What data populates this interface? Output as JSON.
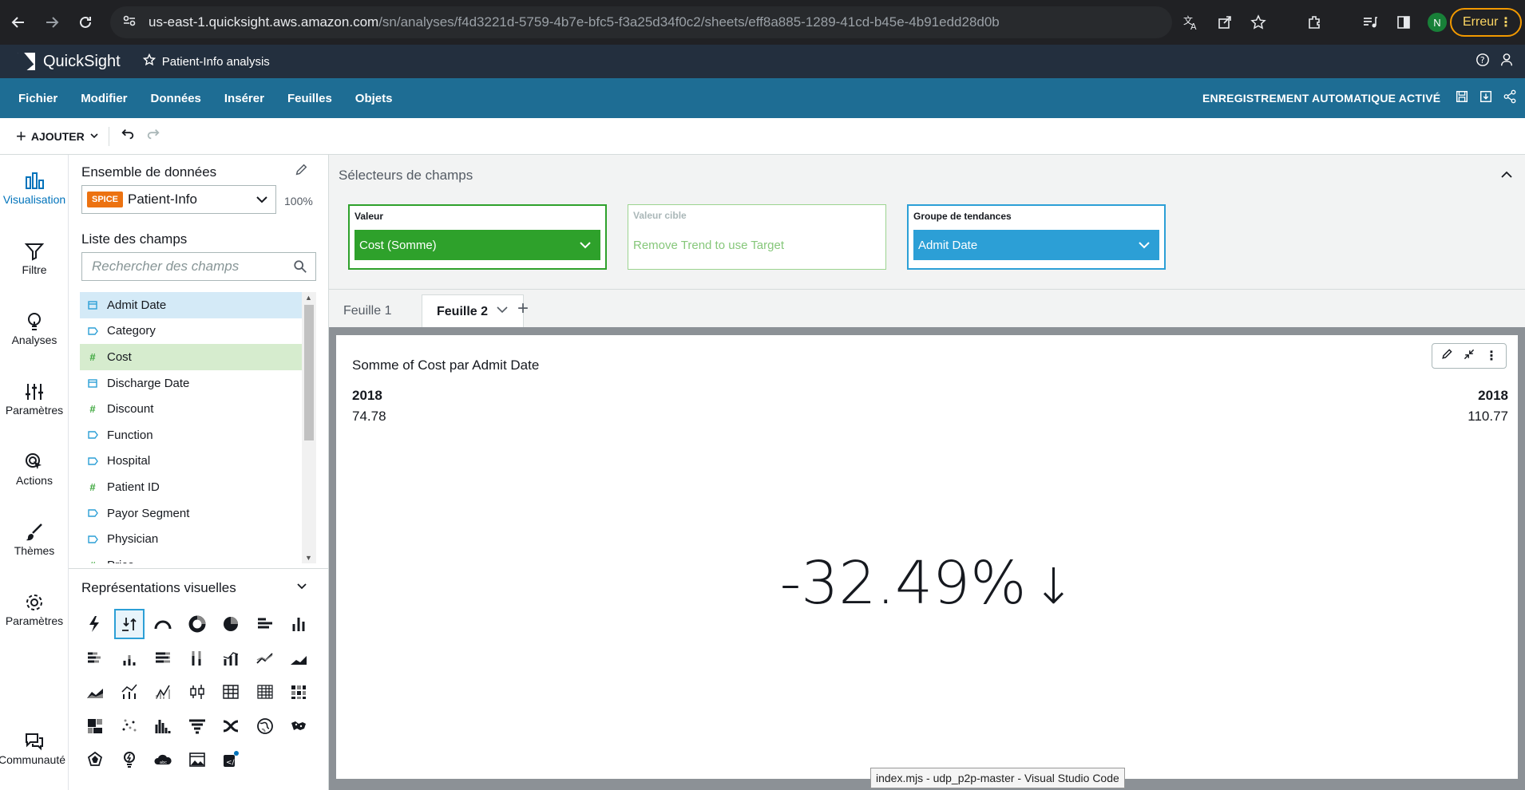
{
  "browser": {
    "url_host": "us-east-1.quicksight.aws.amazon.com",
    "url_path": "/sn/analyses/f4d3221d-5759-4b7e-bfc5-f3a25d34f0c2/sheets/eff8a885-1289-41cd-b45e-4b91edd28d0b",
    "profile_initial": "N",
    "error_label": "Erreur"
  },
  "header": {
    "app_name": "QuickSight",
    "analysis_name": "Patient-Info analysis"
  },
  "menu": {
    "items": [
      "Fichier",
      "Modifier",
      "Données",
      "Insérer",
      "Feuilles",
      "Objets"
    ],
    "autosave": "ENREGISTREMENT AUTOMATIQUE ACTIVÉ"
  },
  "toolbar": {
    "add_label": "AJOUTER"
  },
  "rail": {
    "items": [
      "Visualisation",
      "Filtre",
      "Analyses",
      "Paramètres",
      "Actions",
      "Thèmes",
      "Paramètres",
      "Communauté"
    ]
  },
  "dataset": {
    "title": "Ensemble de données",
    "badge": "SPICE",
    "name": "Patient-Info",
    "percent": "100%",
    "fields_title": "Liste des champs",
    "search_placeholder": "Rechercher des champs",
    "fields": [
      {
        "name": "Admit Date",
        "type": "date"
      },
      {
        "name": "Category",
        "type": "dim"
      },
      {
        "name": "Cost",
        "type": "meas"
      },
      {
        "name": "Discharge Date",
        "type": "date"
      },
      {
        "name": "Discount",
        "type": "meas"
      },
      {
        "name": "Function",
        "type": "dim"
      },
      {
        "name": "Hospital",
        "type": "dim"
      },
      {
        "name": "Patient ID",
        "type": "meas"
      },
      {
        "name": "Payor Segment",
        "type": "dim"
      },
      {
        "name": "Physician",
        "type": "dim"
      },
      {
        "name": "Price",
        "type": "meas"
      }
    ]
  },
  "visuals_panel": {
    "title": "Représentations visuelles"
  },
  "field_wells": {
    "title": "Sélecteurs de champs",
    "value_label": "Valeur",
    "value_field": "Cost (Somme)",
    "target_label": "Valeur cible",
    "target_hint": "Remove Trend to use Target",
    "trend_label": "Groupe de tendances",
    "trend_field": "Admit Date"
  },
  "sheets": {
    "tab1": "Feuille 1",
    "tab2": "Feuille 2"
  },
  "visual": {
    "title": "Somme of Cost par Admit Date",
    "left_label": "2018",
    "left_value": "74.78",
    "right_label": "2018",
    "right_value": "110.77",
    "change": "-32.49%",
    "arrow": "↓"
  },
  "tooltip": {
    "text": "index.mjs - udp_p2p-master - Visual Studio Code"
  },
  "colors": {
    "menu_bg": "#1e6d94",
    "header_bg": "#232f3e",
    "value_well": "#2ea12b",
    "trend_well": "#2c9fd6",
    "spice": "#ec7211"
  }
}
